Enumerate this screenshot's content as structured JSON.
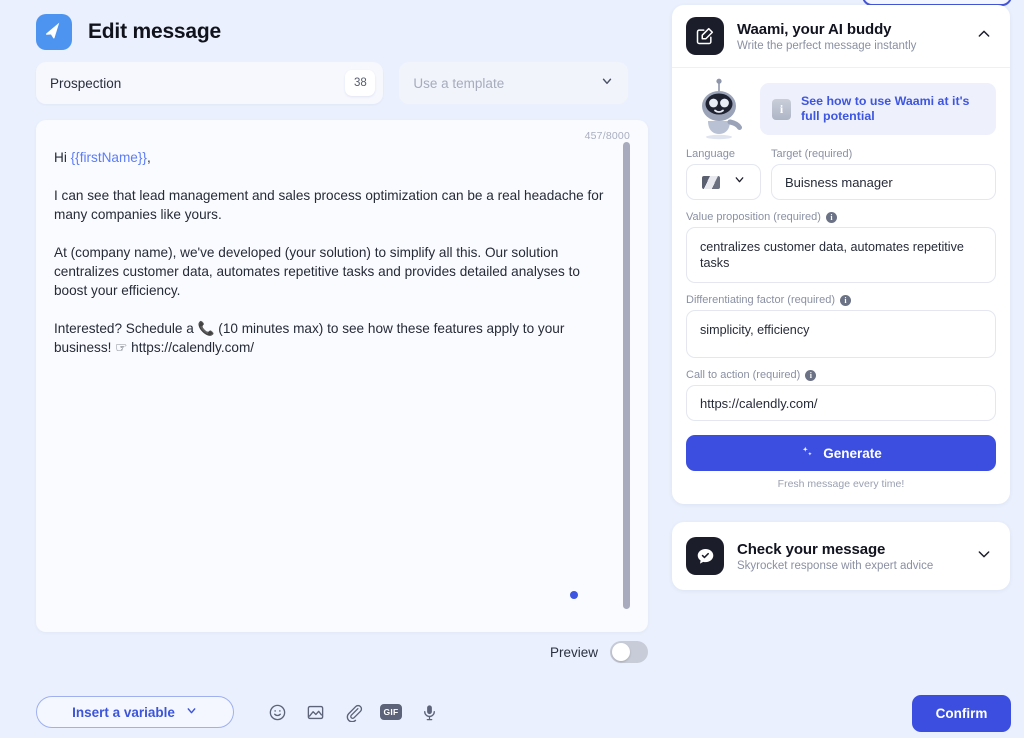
{
  "header": {
    "title": "Edit message",
    "app_icon": "paper-plane-icon"
  },
  "fields": {
    "name_value": "Prospection",
    "name_count": "38",
    "template_placeholder": "Use a template",
    "template_chevron": "chevron-down-icon"
  },
  "editor": {
    "char_count": "457/8000",
    "paragraphs": [
      {
        "prefix": "Hi ",
        "variable": "{{firstName}}",
        "suffix": ","
      },
      {
        "text": "I can see that lead management and sales process optimization can be a real headache for many companies like yours."
      },
      {
        "text": "At (company name), we've developed (your solution) to simplify all this. Our solution centralizes customer data, automates repetitive tasks and provides detailed analyses to boost your efficiency."
      },
      {
        "text": "Interested? Schedule a 📞 (10 minutes max) to see how these features apply to your business! ☞ https://calendly.com/"
      }
    ]
  },
  "preview": {
    "label": "Preview",
    "enabled": false
  },
  "bottom_bar": {
    "insert_variable_label": "Insert a variable",
    "insert_variable_chevron": "chevron-down-icon",
    "tools": [
      {
        "name": "emoji-icon",
        "label": "Emoji"
      },
      {
        "name": "image-icon",
        "label": "Image"
      },
      {
        "name": "attachment-icon",
        "label": "Attachment"
      },
      {
        "name": "gif-icon",
        "label": "GIF"
      },
      {
        "name": "microphone-icon",
        "label": "Voice"
      }
    ],
    "gif_label": "GIF",
    "confirm_label": "Confirm"
  },
  "waami_panel": {
    "icon": "compose-square-icon",
    "title": "Waami, your AI buddy",
    "subtitle": "Write the perfect message instantly",
    "collapse_icon": "chevron-up-icon",
    "mascot": "robot-mascot",
    "promo_icon": "info-square-icon",
    "promo_text": "See how to use Waami at it's full potential",
    "language": {
      "label": "Language",
      "flag": "flag-icon",
      "chevron": "chevron-down-icon"
    },
    "target": {
      "label": "Target (required)",
      "value": "Buisness manager"
    },
    "value_proposition": {
      "label": "Value proposition (required)",
      "info": "info-icon",
      "value": "centralizes customer data, automates repetitive tasks"
    },
    "differentiating_factor": {
      "label": "Differentiating factor (required)",
      "info": "info-icon",
      "value": "simplicity, efficiency"
    },
    "call_to_action": {
      "label": "Call to action (required)",
      "info": "info-icon",
      "value": "https://calendly.com/"
    },
    "generate_label": "Generate",
    "generate_icon": "sparkle-icon",
    "generate_note": "Fresh message every time!"
  },
  "check_panel": {
    "icon": "chat-check-icon",
    "title": "Check your message",
    "subtitle": "Skyrocket response with expert advice",
    "expand_icon": "chevron-down-icon"
  },
  "colors": {
    "page_bg": "#eaf0fd",
    "primary": "#3b4ee0",
    "accent_light": "#4d94f0",
    "variable_token": "#5b7cfa",
    "panel_dark": "#1b1d2b"
  }
}
